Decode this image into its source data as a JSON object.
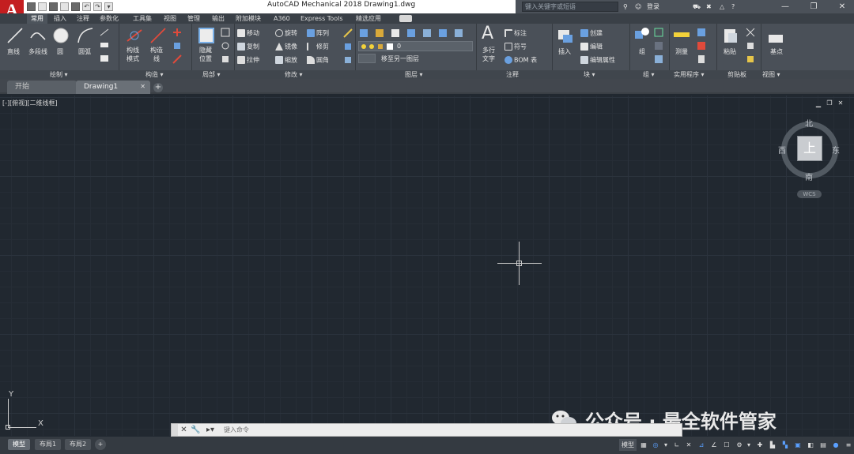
{
  "app": {
    "logo_letter": "A",
    "logo_sub": "",
    "title": "AutoCAD Mechanical 2018    Drawing1.dwg",
    "search_placeholder": "键入关键字或短语",
    "login": "登录"
  },
  "menu_tabs": [
    "常用",
    "插入",
    "注释",
    "参数化",
    "工具集",
    "视图",
    "管理",
    "输出",
    "附加模块",
    "A360",
    "Express Tools",
    "精选应用"
  ],
  "ribbon": {
    "draw": {
      "line": "直线",
      "polyline": "多段线",
      "circle": "圆",
      "arc": "圆弧",
      "panel": "绘制"
    },
    "construct": {
      "construction_line": "构线",
      "construction_line2": "模式",
      "construction": "构造",
      "construction2": "线",
      "panel": "构造"
    },
    "detail": {
      "hide_line": "隐藏",
      "hide_line2": "位置",
      "panel": "局部"
    },
    "modify": {
      "move": "移动",
      "rotate": "旋转",
      "array": "阵列",
      "copy": "复制",
      "mirror": "镜像",
      "trim": "修剪",
      "stretch": "拉伸",
      "scale": "缩放",
      "fillet": "圆角",
      "panel": "修改"
    },
    "layer": {
      "current_layer": "0",
      "move_to_layer": "移至另一图层",
      "panel": "图层"
    },
    "annotation": {
      "mtext": "多行",
      "mtext2": "文字",
      "dimension": "标注",
      "symbol": "符号",
      "bom": "BOM 表",
      "panel": "注释"
    },
    "block": {
      "insert": "插入",
      "create": "创建",
      "edit": "编辑",
      "edit_attr": "编辑属性",
      "panel": "块"
    },
    "group": {
      "group": "组",
      "panel": "组"
    },
    "utilities": {
      "measure": "测量",
      "panel": "实用程序"
    },
    "clipboard": {
      "paste": "粘贴",
      "panel": "剪贴板"
    },
    "view": {
      "base": "基点",
      "panel": "视图"
    }
  },
  "doc_tabs": {
    "start": "开始",
    "drawing": "Drawing1"
  },
  "viewport": {
    "label": "[-][俯视][二维线框]",
    "cube_face": "上",
    "north": "北",
    "south": "南",
    "east": "东",
    "west": "西",
    "wcs": "WCS"
  },
  "ucs": {
    "x": "X",
    "y": "Y"
  },
  "command": {
    "placeholder": "键入命令"
  },
  "layouts": [
    "模型",
    "布局1",
    "布局2"
  ],
  "status": {
    "model": "模型"
  },
  "watermark": "公众号 · 最全软件管家"
}
